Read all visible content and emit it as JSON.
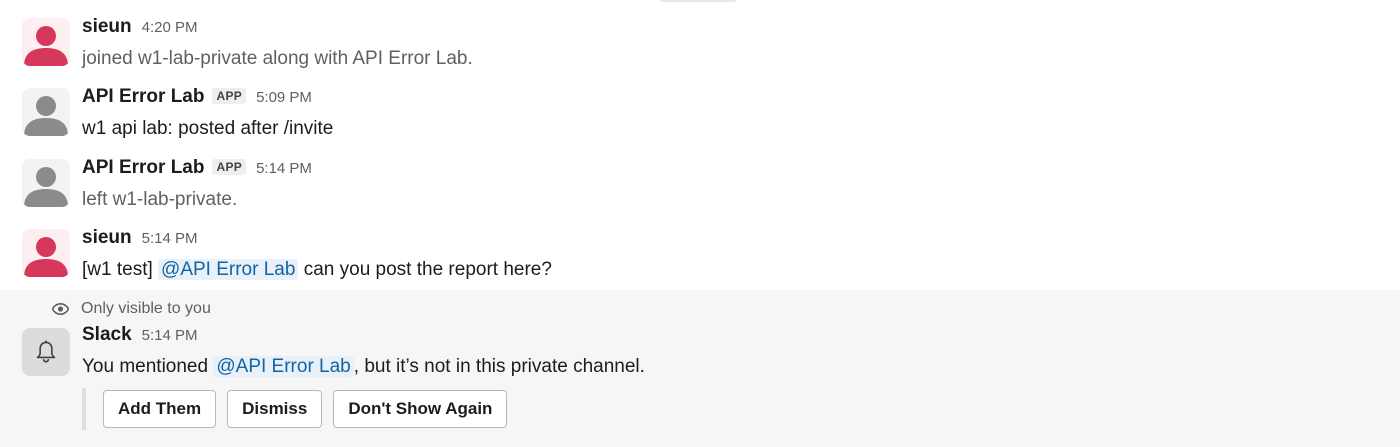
{
  "messages": [
    {
      "sender": "sieun",
      "time": "4:20 PM",
      "text": "joined w1-lab-private along with API Error Lab.",
      "avatar": "user-avatar-red"
    },
    {
      "sender": "API Error Lab",
      "badge": "APP",
      "time": "5:09 PM",
      "text": "w1 api lab: posted after /invite",
      "avatar": "user-avatar-gray"
    },
    {
      "sender": "API Error Lab",
      "badge": "APP",
      "time": "5:14 PM",
      "text": "left w1-lab-private.",
      "avatar": "user-avatar-gray"
    },
    {
      "sender": "sieun",
      "time": "5:14 PM",
      "text_before": "[w1 test]",
      "mention": "@API Error Lab",
      "text_after": "can you post the report here?",
      "avatar": "user-avatar-red"
    }
  ],
  "ephemeral": {
    "visibility_note": "Only visible to you",
    "sender": "Slack",
    "time": "5:14 PM",
    "text_before": "You mentioned",
    "mention": "@API Error Lab",
    "text_after": ", but it’s not in this private channel.",
    "buttons": {
      "add_them": "Add Them",
      "dismiss": "Dismiss",
      "dont_show_again": "Don't Show Again"
    }
  },
  "colors": {
    "avatar_red_bg": "#fdeef2",
    "avatar_red_fg": "#d6385c",
    "avatar_gray_bg": "#f3f3f3",
    "avatar_gray_fg": "#8b8b8b",
    "mention": "#1264a3",
    "ephemeral_bg": "#f6f6f6"
  }
}
